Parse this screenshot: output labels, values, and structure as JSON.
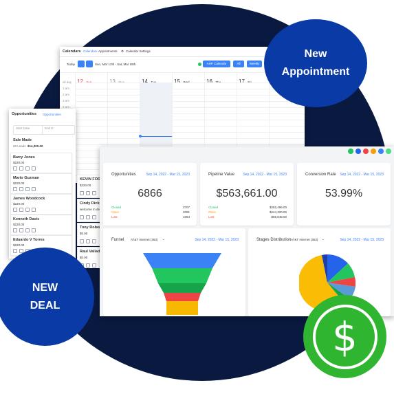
{
  "calendar": {
    "title": "Calendars",
    "tabs": [
      "Calendars",
      "Appointments"
    ],
    "settings": "Calendar Settings",
    "today": "Today",
    "range": "Sun, Mar 12th - Sat, Mar 18th",
    "calendar_select": "AHP Calendar",
    "filter": "All",
    "view": "Weekly",
    "days": [
      {
        "num": "12",
        "name": "Sun"
      },
      {
        "num": "13",
        "name": "Mon"
      },
      {
        "num": "14",
        "name": "Tue"
      },
      {
        "num": "15",
        "name": "Wed"
      },
      {
        "num": "16",
        "name": "Thu"
      },
      {
        "num": "17",
        "name": "Fri"
      }
    ],
    "times": [
      "all day",
      "1 am",
      "2 am",
      "3 am",
      "4 am",
      "5 am",
      "6 am",
      "7 am",
      "8 am",
      "9 am",
      "10 am",
      "11 am",
      "12 pm",
      "1 pm",
      "2 pm",
      "3 pm",
      "4 pm"
    ]
  },
  "opportunities": {
    "title": "Opportunities",
    "tab": "Opportunities",
    "start_date": "Start Date",
    "end_date": "End D",
    "column": {
      "name": "Sale Made",
      "leads": "88 Leads",
      "amount": "$14,300.00"
    },
    "deals": [
      {
        "name": "Barry Jones",
        "value": "$220.00"
      },
      {
        "name": "Mario Guzman",
        "value": "$220.00"
      },
      {
        "name": "James Woodcock",
        "value": "$220.00"
      },
      {
        "name": "Kenneth Davis",
        "value": "$220.00"
      },
      {
        "name": "Eduardo V Torres",
        "value": "$220.00"
      }
    ],
    "deals_right": [
      {
        "name": "KEVIN FORD",
        "value": "$220.00"
      },
      {
        "name": "Cindy Dickso",
        "value": "welcome to demo"
      },
      {
        "name": "Tony Roberts",
        "value": "$0.00"
      },
      {
        "name": "Raul Valladar",
        "value": "$0.00"
      }
    ]
  },
  "dashboard": {
    "cards": [
      {
        "title": "Opportunities",
        "date": "Sep 14, 2022 - Mar 15, 2023",
        "value": "6866",
        "rows": [
          {
            "label": "Closed",
            "value": "3707",
            "color": "#22c55e"
          },
          {
            "label": "Open",
            "value": "2091",
            "color": "#f59e0b"
          },
          {
            "label": "Lost",
            "value": "1064",
            "color": "#ef4444"
          }
        ]
      },
      {
        "title": "Pipeline Value",
        "date": "Sep 14, 2022 - Mar 15, 2023",
        "value": "$563,661.00",
        "rows": [
          {
            "label": "Closed",
            "value": "$262,496.00",
            "color": "#22c55e"
          },
          {
            "label": "Open",
            "value": "$244,320.00",
            "color": "#f59e0b"
          },
          {
            "label": "Lost",
            "value": "$56,845.00",
            "color": "#ef4444"
          }
        ]
      },
      {
        "title": "Conversion Rate",
        "date": "Sep 14, 2022 - Mar 15, 2023",
        "value": "53.99%"
      }
    ],
    "funnel": {
      "title": "Funnel",
      "pipeline": "AT&T Internet (363)",
      "date": "Sep 14, 2022 - Mar 15, 2023",
      "colors": [
        "#3b82f6",
        "#22c55e",
        "#16a34a",
        "#ef4444",
        "#f6b800"
      ]
    },
    "stages": {
      "title": "Stages Distribution",
      "pipeline": "AT&T Internet (363)",
      "date": "Sep 14, 2022 - Mar 15, 2023",
      "colors": [
        "#fbbc05",
        "#1e40af",
        "#2563eb",
        "#22c55e",
        "#ef4444",
        "#5b9bd5",
        "#16a34a"
      ]
    }
  },
  "badges": {
    "appointment": [
      "New",
      "Appointment"
    ],
    "deal": [
      "NEW",
      "DEAL"
    ],
    "dollar": "$"
  },
  "icon_colors": [
    "#22c55e",
    "#2563eb",
    "#ef4444",
    "#f59e0b",
    "#3b82f6",
    "#4ade80"
  ]
}
